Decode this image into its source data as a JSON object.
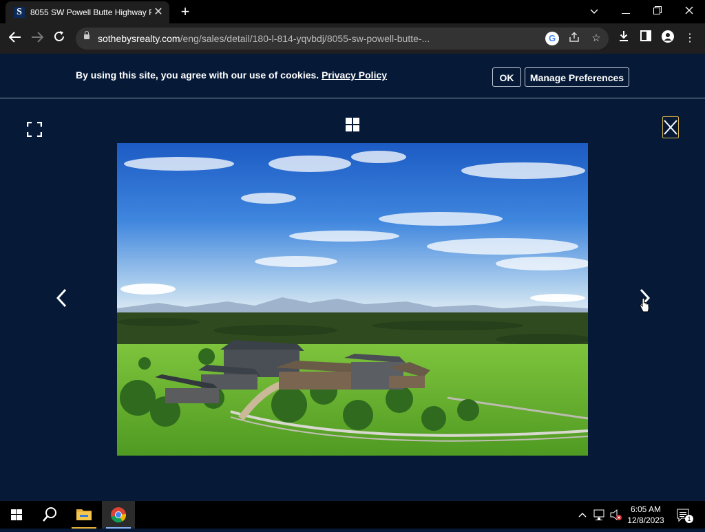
{
  "browser": {
    "tab_title": "8055 SW Powell Butte Highway P",
    "favicon_letter": "S",
    "url_domain": "sothebysrealty.com",
    "url_path": "/eng/sales/detail/180-l-814-yqvbdj/8055-sw-powell-butte-..."
  },
  "cookie_banner": {
    "message": "By using this site, you agree with our use of cookies.",
    "link_label": "Privacy Policy",
    "ok_label": "OK",
    "manage_label": "Manage Preferences"
  },
  "taskbar": {
    "time": "6:05 AM",
    "date": "12/8/2023",
    "notification_count": "1"
  },
  "colors": {
    "page_background": "#061a38",
    "close_button_border": "#d9b24a"
  }
}
